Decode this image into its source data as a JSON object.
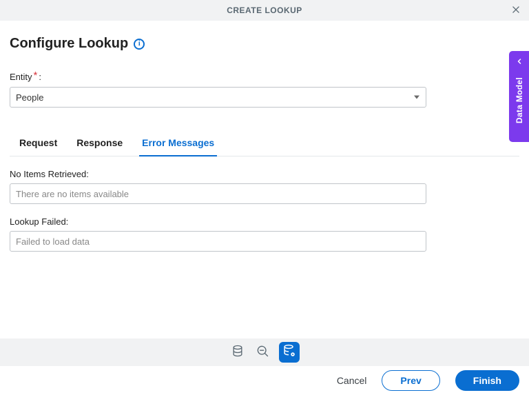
{
  "header": {
    "title": "CREATE LOOKUP"
  },
  "page": {
    "heading": "Configure Lookup"
  },
  "entity": {
    "label": "Entity",
    "selected": "People"
  },
  "tabs": {
    "request": "Request",
    "response": "Response",
    "error_messages": "Error Messages"
  },
  "fields": {
    "no_items_label": "No Items Retrieved:",
    "no_items_value": "There are no items available",
    "lookup_failed_label": "Lookup Failed:",
    "lookup_failed_value": "Failed to load data"
  },
  "side_panel": {
    "label": "Data Model"
  },
  "footer": {
    "cancel": "Cancel",
    "prev": "Prev",
    "finish": "Finish"
  }
}
